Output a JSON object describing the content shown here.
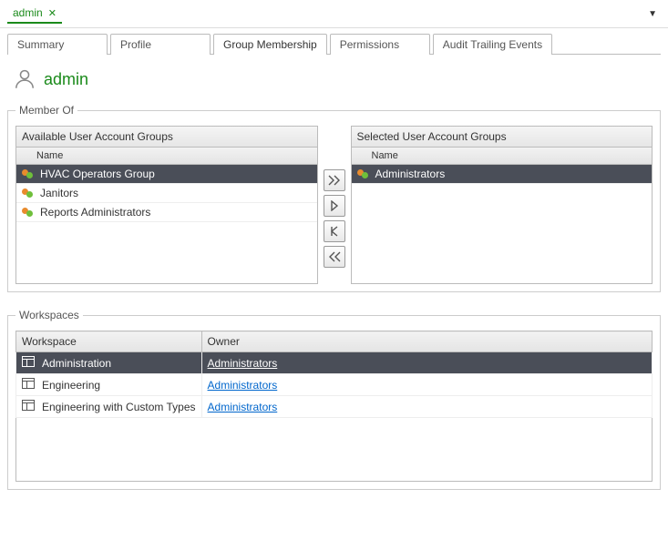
{
  "doc_tab": {
    "label": "admin"
  },
  "tabs": {
    "summary": "Summary",
    "profile": "Profile",
    "group_membership": "Group Membership",
    "permissions": "Permissions",
    "audit": "Audit Trailing Events"
  },
  "page": {
    "title": "admin"
  },
  "member_of": {
    "legend": "Member Of",
    "available_title": "Available User Account Groups",
    "selected_title": "Selected User Account Groups",
    "col_name": "Name",
    "available": [
      {
        "name": "HVAC Operators Group",
        "selected": true
      },
      {
        "name": "Janitors",
        "selected": false
      },
      {
        "name": "Reports Administrators",
        "selected": false
      }
    ],
    "selected": [
      {
        "name": "Administrators",
        "selected": true
      }
    ]
  },
  "workspaces": {
    "legend": "Workspaces",
    "col_workspace": "Workspace",
    "col_owner": "Owner",
    "rows": [
      {
        "name": "Administration",
        "owner": "Administrators",
        "selected": true
      },
      {
        "name": "Engineering",
        "owner": "Administrators",
        "selected": false
      },
      {
        "name": "Engineering with Custom Types",
        "owner": "Administrators",
        "selected": false
      }
    ]
  }
}
